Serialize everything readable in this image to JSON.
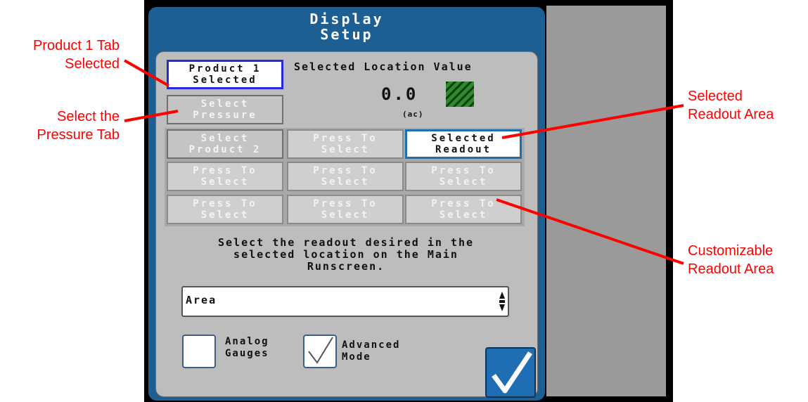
{
  "dialog": {
    "title": "Display\nSetup",
    "selected_location_label": "Selected Location Value",
    "value": "0.0",
    "unit": "(ac)",
    "tabs": {
      "product1": "Product 1\nSelected",
      "pressure": "Select\nPressure"
    },
    "grid": [
      "Select\nProduct 2",
      "Press To\nSelect",
      "Selected\nReadout",
      "Press To\nSelect",
      "Press To\nSelect",
      "Press To\nSelect",
      "Press To\nSelect",
      "Press To\nSelect",
      "Press To\nSelect"
    ],
    "instruction": "Select the readout desired in the\nselected location on the Main\nRunscreen.",
    "select_value": "Area",
    "checkbox_analog_label": "Analog\nGauges",
    "checkbox_advanced_label": "Advanced\nMode",
    "checkbox_analog_checked": false,
    "checkbox_advanced_checked": true
  },
  "annotations": {
    "product1_tab": "Product 1 Tab\nSelected",
    "pressure_tab": "Select the\nPressure Tab",
    "selected_readout": "Selected\nReadout Area",
    "customizable_readout": "Customizable\nReadout Area"
  },
  "colors": {
    "annotation": "#ff0000",
    "dialog_header": "#1d5f92",
    "panel": "#bdbdbd",
    "selected_border_blue": "#2b2bd6"
  }
}
